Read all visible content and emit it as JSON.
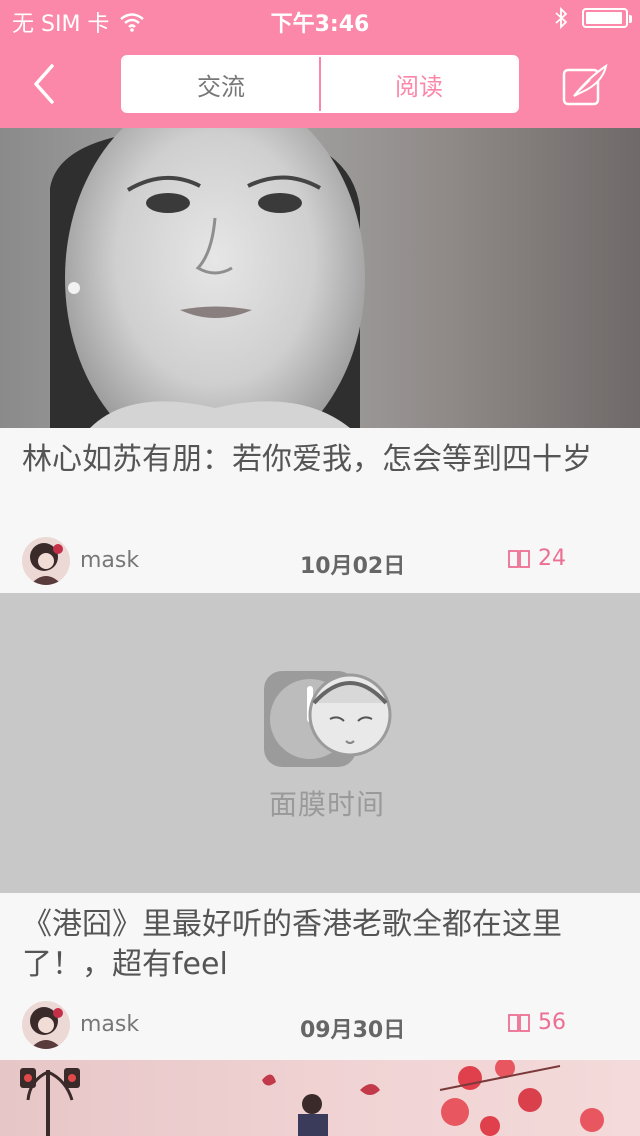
{
  "status_bar": {
    "carrier": "无 SIM 卡",
    "time": "下午3:46",
    "battery_level": 0.95
  },
  "nav": {
    "tabs": [
      {
        "label": "交流",
        "active": false
      },
      {
        "label": "阅读",
        "active": true
      }
    ]
  },
  "articles": [
    {
      "title": "林心如苏有朋：若你爱我，怎会等到四十岁",
      "author": "mask",
      "date": "10月02日",
      "read_count": "24"
    },
    {
      "title": "《港囧》里最好听的香港老歌全都在这里了！，超有feel",
      "author": "mask",
      "date": "09月30日",
      "read_count": "56",
      "image_placeholder_text": "面膜时间"
    }
  ],
  "colors": {
    "header": "#fb88a9",
    "accent": "#ec6f93",
    "placeholder_bg": "#c8c8c8"
  },
  "icons": {
    "back": "chevron-left-icon",
    "compose": "edit-feather-icon",
    "read": "book-open-icon",
    "wifi": "wifi-icon",
    "bluetooth": "bluetooth-icon"
  }
}
